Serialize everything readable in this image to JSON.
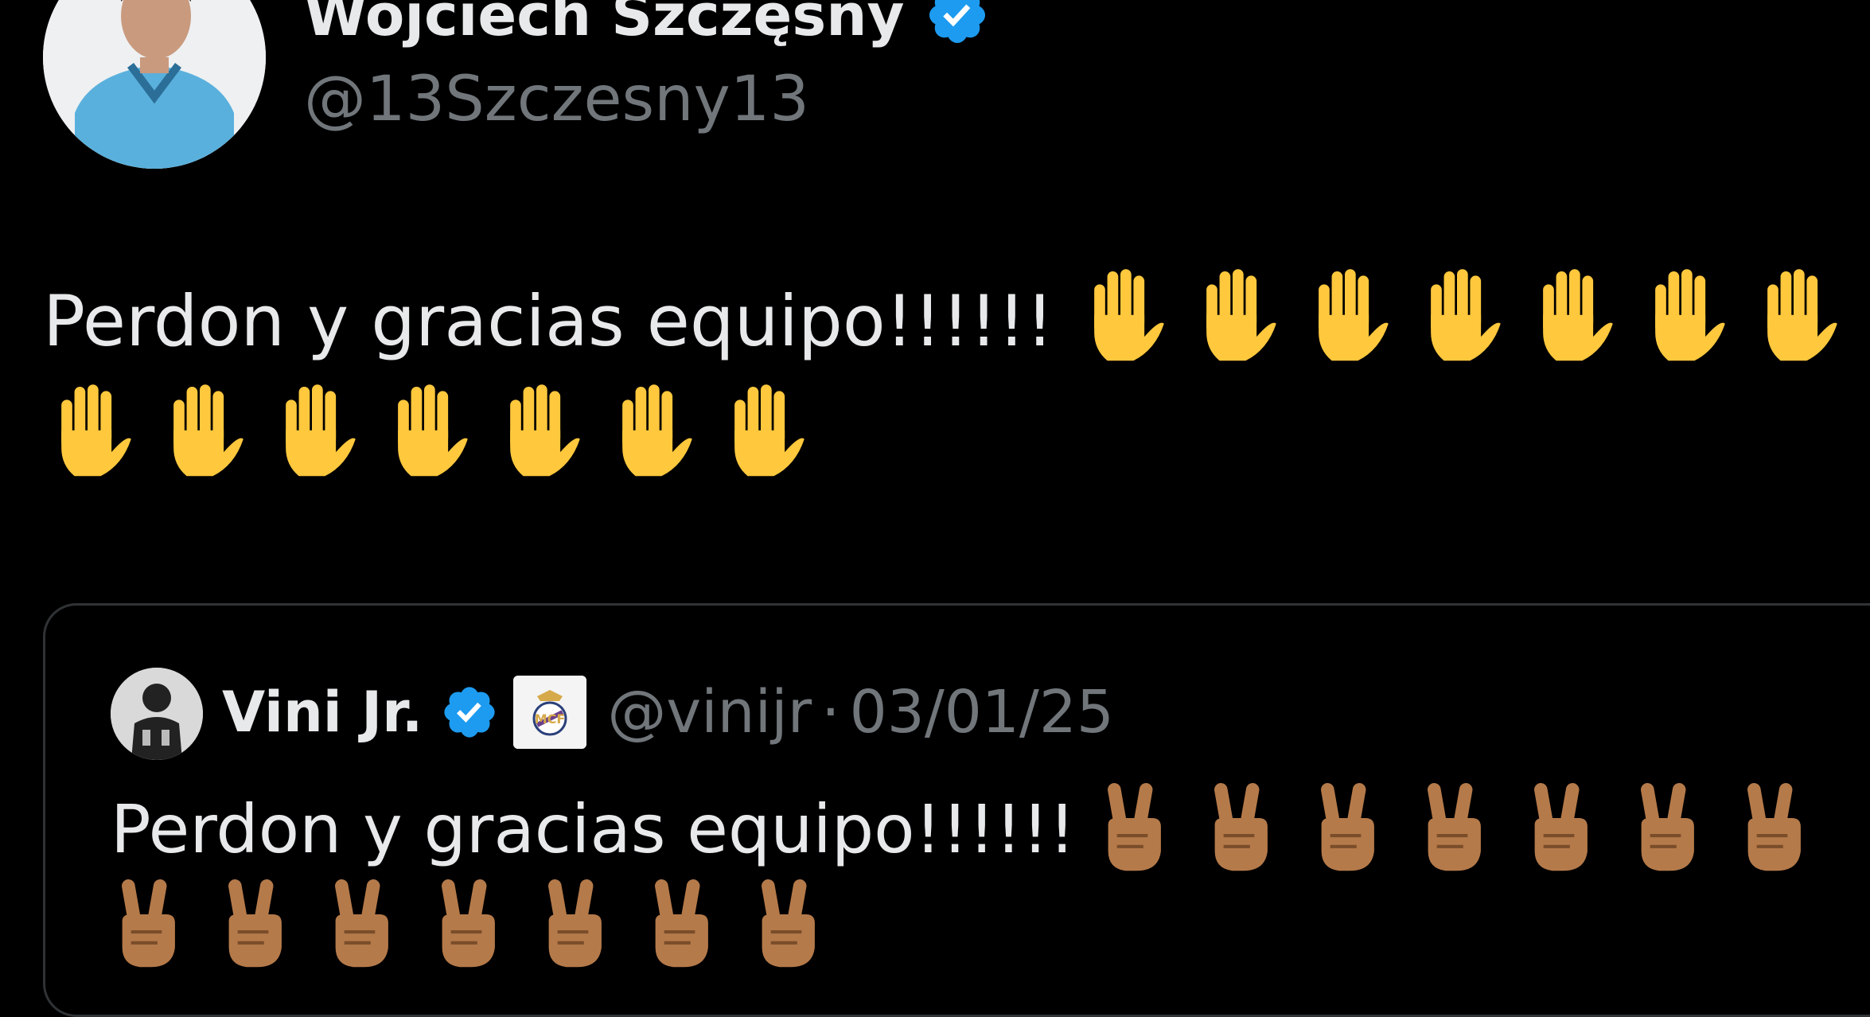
{
  "post": {
    "author_name": "Wojciech Szczęsny",
    "handle": "@13Szczesny13",
    "text": "Perdon y gracias equipo!!!!!!",
    "emoji": "raised-hand",
    "emoji_count": 14,
    "verified": true
  },
  "quoted_post": {
    "author_name": "Vini Jr.",
    "handle": "@vinijr",
    "separator": "·",
    "date": "03/01/25",
    "text": "Perdon y gracias equipo!!!!!!",
    "emoji": "victory-hand-medium-dark-skin",
    "emoji_count": 14,
    "verified": true,
    "affiliation_badge": "real-madrid-crest"
  },
  "colors": {
    "background": "#000000",
    "text_primary": "#e7e9ea",
    "text_secondary": "#71767b",
    "verified_blue": "#1d9bf0",
    "raised_hand_yellow": "#ffc83d",
    "victory_hand_brown": "#b57a4a",
    "quote_border": "#2f3336"
  }
}
